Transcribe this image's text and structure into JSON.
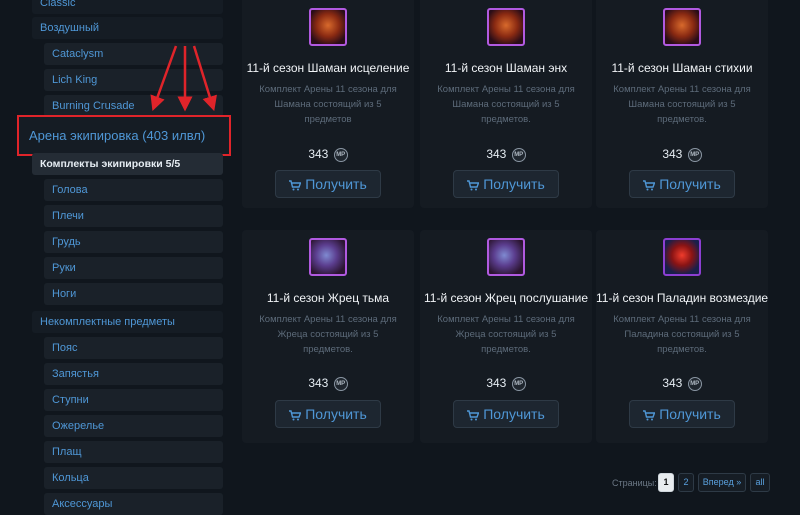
{
  "sidebar": {
    "top_partial": "Classic",
    "vozd": "Воздушный",
    "cataclysm": "Cataclysm",
    "lichking": "Lich King",
    "bc": "Burning Crusade",
    "arena": "Арена экипировка (403 илвл)",
    "sets": "Комплекты экипировки 5/5",
    "slots": [
      "Голова",
      "Плечи",
      "Грудь",
      "Руки",
      "Ноги"
    ],
    "incomplete": "Некомплектные предметы",
    "items": [
      "Пояс",
      "Запястья",
      "Ступни",
      "Ожерелье",
      "Плащ",
      "Кольца",
      "Аксессуары"
    ]
  },
  "cards": [
    {
      "title": "11-й сезон Шаман исцеление",
      "desc": "Комплект Арены 11 сезона для Шамана состоящий из 5 предметов",
      "price": "343",
      "currency": "MP",
      "button": "Получить"
    },
    {
      "title": "11-й сезон Шаман энх",
      "desc": "Комплект Арены 11 сезона для Шамана состоящий из 5 предметов.",
      "price": "343",
      "currency": "MP",
      "button": "Получить"
    },
    {
      "title": "11-й сезон Шаман стихии",
      "desc": "Комплект Арены 11 сезона для Шамана состоящий из 5 предметов.",
      "price": "343",
      "currency": "MP",
      "button": "Получить"
    },
    {
      "title": "11-й сезон Жрец тьма",
      "desc": "Комплект Арены 11 сезона для Жреца состоящий из 5 предметов.",
      "price": "343",
      "currency": "MP",
      "button": "Получить"
    },
    {
      "title": "11-й сезон Жрец послушание",
      "desc": "Комплект Арены 11 сезона для Жреца состоящий из 5 предметов.",
      "price": "343",
      "currency": "MP",
      "button": "Получить"
    },
    {
      "title": "11-й сезон Паладин возмездие",
      "desc": "Комплект Арены 11 сезона для Паладина состоящий из 5 предметов.",
      "price": "343",
      "currency": "MP",
      "button": "Получить"
    }
  ],
  "pagination": {
    "label": "Страницы:",
    "page1": "1",
    "page2": "2",
    "next": "Вперед »",
    "all": "all"
  },
  "colors": {
    "highlight": "#e0242a",
    "link": "#4f97d6"
  }
}
